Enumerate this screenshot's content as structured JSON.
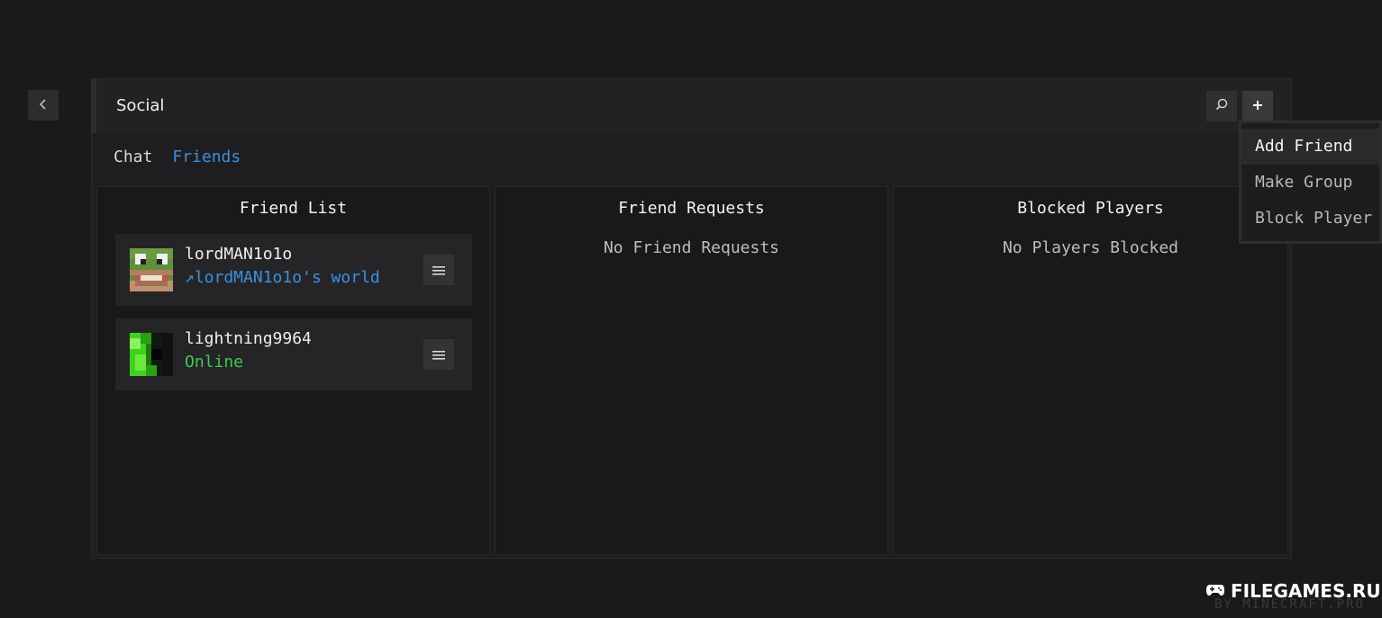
{
  "header": {
    "title": "Social"
  },
  "tabs": [
    {
      "label": "Chat",
      "active": false
    },
    {
      "label": "Friends",
      "active": true
    }
  ],
  "columns": {
    "friend_list": {
      "title": "Friend List",
      "friends": [
        {
          "name": "lordMAN1o1o",
          "status": "↗lordMAN1o1o's world",
          "status_type": "in-world"
        },
        {
          "name": "lightning9964",
          "status": "Online",
          "status_type": "online"
        }
      ]
    },
    "friend_requests": {
      "title": "Friend Requests",
      "empty_text": "No Friend Requests"
    },
    "blocked_players": {
      "title": "Blocked Players",
      "empty_text": "No Players Blocked"
    }
  },
  "add_menu": {
    "items": [
      {
        "label": "Add Friend",
        "highlighted": true
      },
      {
        "label": "Make Group",
        "highlighted": false
      },
      {
        "label": "Block Player",
        "highlighted": false
      }
    ]
  },
  "watermark": {
    "text": "FILEGAMES.RU",
    "subtext": "BY MINECRAFT.PRO"
  },
  "colors": {
    "accent_blue": "#3d8fe0",
    "online_green": "#3fc94f",
    "background": "#1a1a1c"
  },
  "icons": [
    "back-chevron-icon",
    "search-icon",
    "plus-icon",
    "hamburger-menu-icon",
    "gamepad-icon"
  ]
}
